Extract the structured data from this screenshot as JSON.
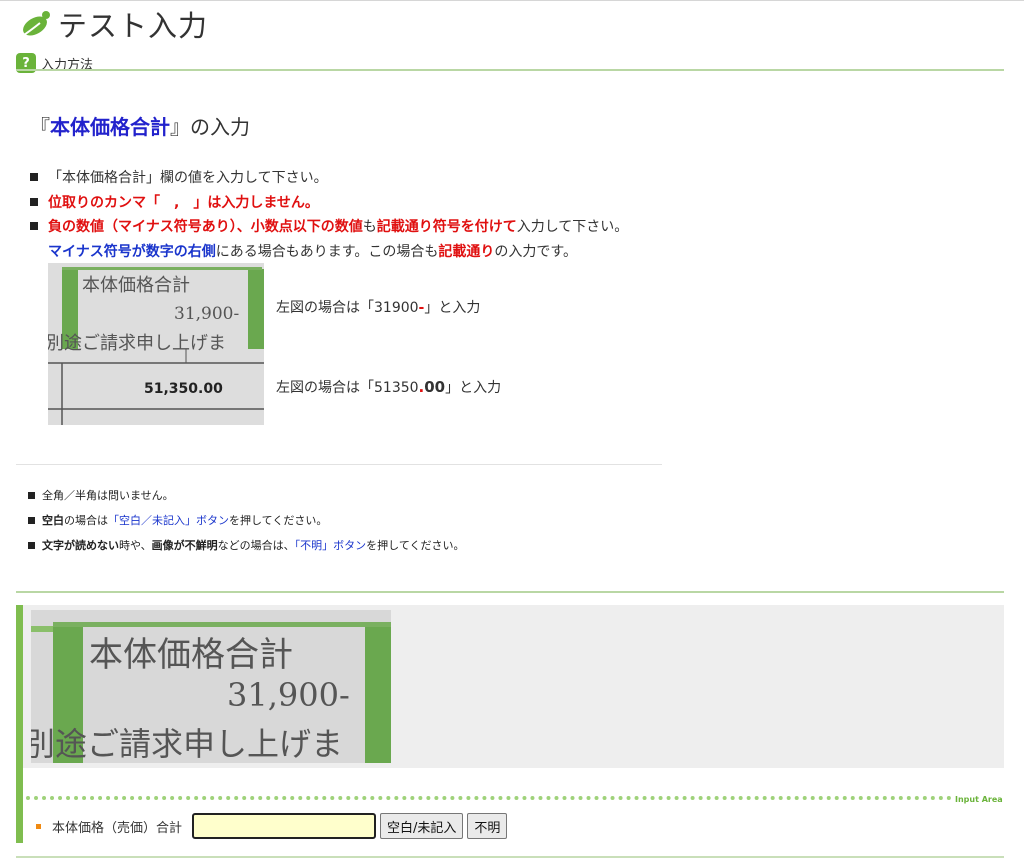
{
  "header": {
    "title": "テスト入力",
    "help_label": "入力方法",
    "help_icon": "?"
  },
  "heading": {
    "open": "『",
    "field": "本体価格合計",
    "close": "』の入力"
  },
  "instructions": {
    "line1": "「本体価格合計」欄の値を入力して下さい。",
    "line2": "位取りのカンマ「　,　」は入力しません。",
    "line3a": "負の数値（マイナス符号あり）、小数点以下の数値",
    "line3b": "も",
    "line3c": "記載通り符号を付けて",
    "line3d": "入力して下さい。",
    "line4a": "マイナス符号が数字の右側",
    "line4b": "にある場合もあります。この場合も",
    "line4c": "記載通り",
    "line4d": "の入力です。"
  },
  "sample": {
    "heading": "本体価格合計",
    "value1": "31,900-",
    "caption": "別途ご請求申し上げま",
    "value2": "51,350.00"
  },
  "examples": {
    "ex1_pre": "左図の場合は「31900",
    "ex1_mark": "-",
    "ex1_post": "」と入力",
    "ex2_pre": "左図の場合は「51350",
    "ex2_mark": ".",
    "ex2_mark2": "00",
    "ex2_post": "」と入力"
  },
  "notes": {
    "n1": "全角／半角は問いません。",
    "n2a": "空白",
    "n2b": "の場合は",
    "n2c": "「空白／未記入」ボタン",
    "n2d": "を押してください。",
    "n3a": "文字が読めない",
    "n3b": "時や、",
    "n3c": "画像が不鮮明",
    "n3d": "などの場合は、",
    "n3e": "「不明」ボタン",
    "n3f": "を押してください。"
  },
  "crop": {
    "heading": "本体価格合計",
    "value": "31,900-",
    "caption": "別途ご請求申し上げま"
  },
  "input_area": {
    "label": "Input Area",
    "field_label": "本体価格（売価）合計",
    "value": "",
    "blank_button": "空白/未記入",
    "unknown_button": "不明"
  },
  "colors": {
    "accent_green": "#7fbd4f",
    "highlight_red": "#e01010",
    "highlight_blue": "#1a35cc",
    "input_bg": "#ffffcc"
  }
}
